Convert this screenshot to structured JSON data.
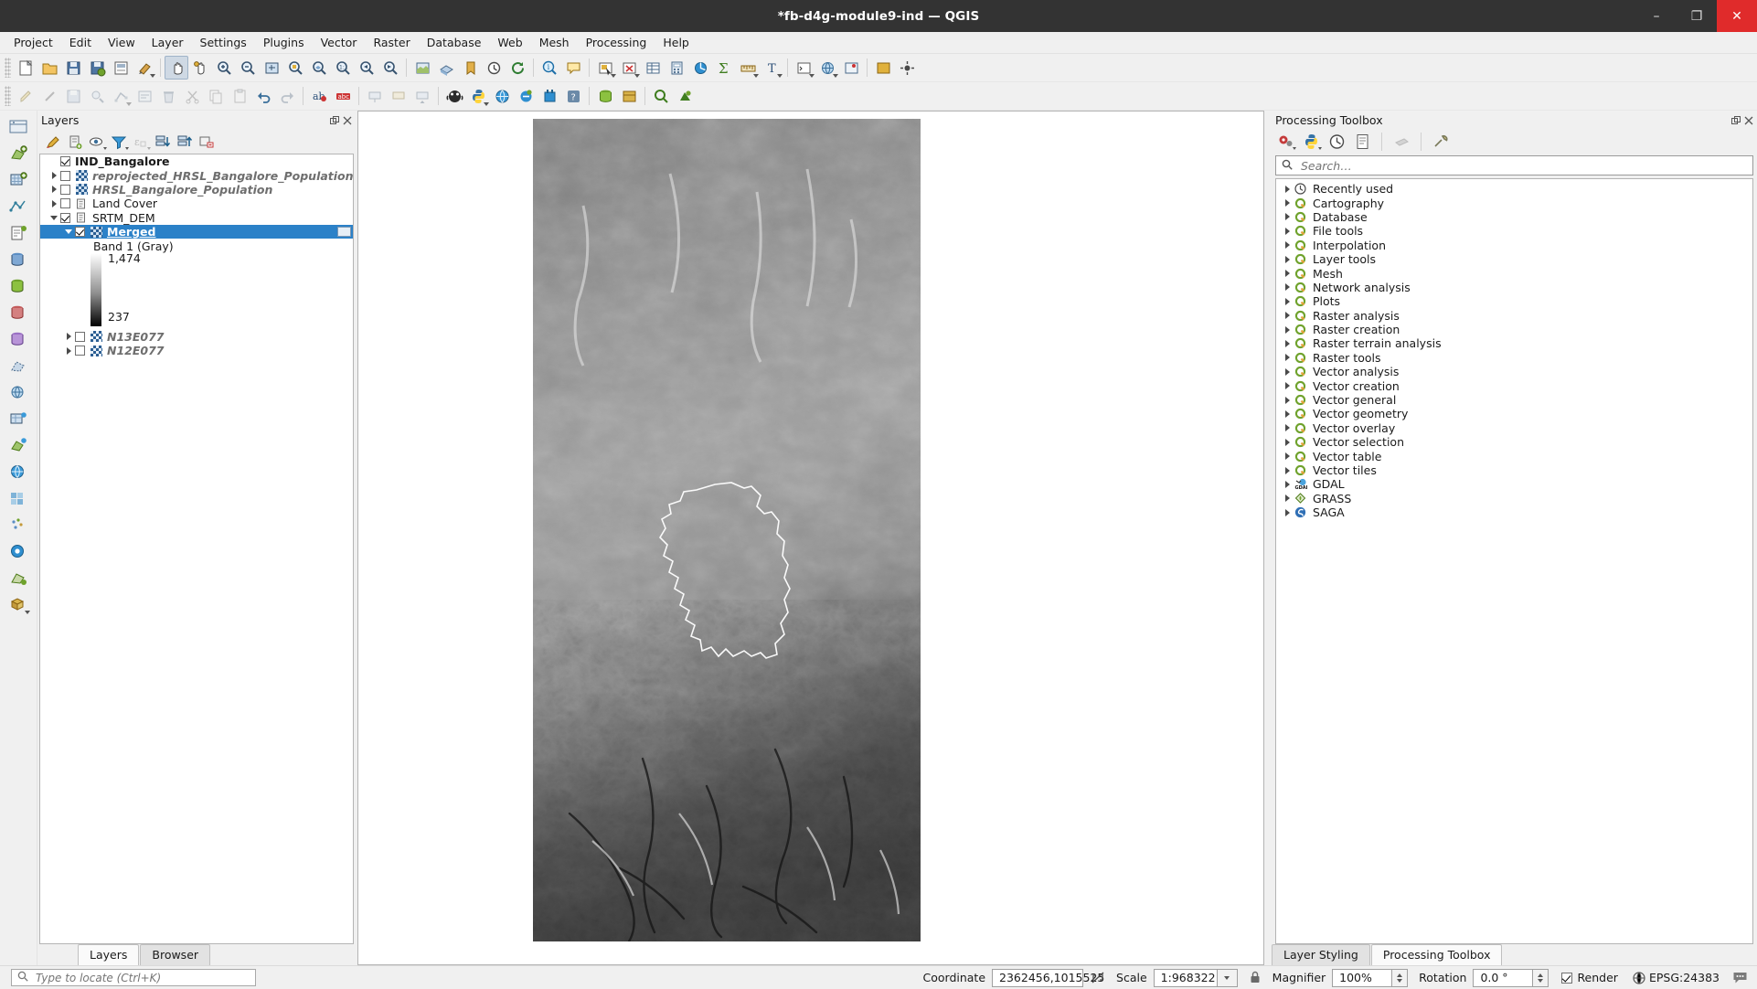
{
  "window": {
    "title": "*fb-d4g-module9-ind — QGIS",
    "minimize": "–",
    "maximize": "❐",
    "close": "✕"
  },
  "menubar": {
    "items": [
      "Project",
      "Edit",
      "View",
      "Layer",
      "Settings",
      "Plugins",
      "Vector",
      "Raster",
      "Database",
      "Web",
      "Mesh",
      "Processing",
      "Help"
    ]
  },
  "toolbars": {
    "row1_icons": [
      "new-project-icon",
      "open-project-icon",
      "save-project-icon",
      "save-project-as-icon",
      "new-print-layout-icon",
      "style-manager-icon",
      "pan-map-icon",
      "pan-to-selection-icon",
      "zoom-in-icon",
      "zoom-out-icon",
      "zoom-full-icon",
      "zoom-selection-icon",
      "zoom-layer-icon",
      "zoom-native-icon",
      "zoom-last-icon",
      "zoom-next-icon",
      "refresh-icon",
      "new-map-view-icon",
      "new-3d-map-view-icon",
      "show-bookmarks-icon",
      "temporal-controller-icon",
      "refresh-map-icon",
      "identify-features-icon",
      "map-tips-icon",
      "measure-icon",
      "select-features-icon",
      "deselect-icon",
      "open-attribute-table-icon",
      "field-calculator-icon",
      "statistical-summary-icon",
      "sum-icon",
      "measure-line-icon",
      "text-annotation-icon",
      "python-console-icon",
      "add-wms-icon",
      "georeferencer-icon",
      "mesh-calculator-icon",
      "add-delimited-text-icon"
    ],
    "row2_icons": [
      "pencil-edit-icon",
      "toggle-editing-icon",
      "save-layer-edits-icon",
      "add-feature-icon",
      "vertex-tool-icon",
      "modify-attributes-icon",
      "delete-selected-icon",
      "cut-features-icon",
      "copy-features-icon",
      "paste-features-icon",
      "undo-icon",
      "redo-icon",
      "label-icon",
      "pin-labels-icon",
      "show-hide-labels-icon",
      "highlight-labels-icon",
      "move-label-icon",
      "rotate-label-icon",
      "change-label-icon",
      "processing-toolbox-icon",
      "python-icon",
      "globe-icon",
      "metasearch-icon",
      "plugin-icon",
      "help-icon",
      "db-manager-icon",
      "geopackage-icon",
      "search-icon",
      "qgis-icon"
    ]
  },
  "left_rail": {
    "icons": [
      "open-data-source-manager-icon",
      "add-vector-layer-icon",
      "add-raster-layer-icon",
      "add-mesh-layer-icon",
      "add-delimited-text-layer-icon",
      "add-postgis-layer-icon",
      "add-spatialite-layer-icon",
      "add-mssql-layer-icon",
      "add-oracle-layer-icon",
      "add-virtual-layer-icon",
      "add-wms-layer-icon",
      "add-wcs-layer-icon",
      "add-wfs-layer-icon",
      "add-xyz-layer-icon",
      "add-vector-tile-layer-icon",
      "add-point-cloud-layer-icon",
      "add-arcgis-layer-icon",
      "new-shapefile-layer-icon",
      "new-geopackage-layer-icon"
    ]
  },
  "layers_panel": {
    "title": "Layers",
    "float_icon": "float-panel-icon",
    "close_icon": "close-panel-icon",
    "toolbar_icons": [
      "open-layer-styling-panel-icon",
      "add-group-icon",
      "manage-layer-visibility-icon",
      "filter-legend-icon",
      "filter-legend-by-expression-icon",
      "expand-all-icon",
      "collapse-all-icon",
      "remove-layer-icon"
    ],
    "tree": [
      {
        "label": "IND_Bangalore",
        "indent": 0,
        "checked": true,
        "expander": "none",
        "style": "bold",
        "icon": "none",
        "selected": false
      },
      {
        "label": "reprojected_HRSL_Bangalore_Population",
        "indent": 0,
        "checked": false,
        "expander": "right",
        "style": "italic",
        "icon": "raster-chip",
        "selected": false
      },
      {
        "label": "HRSL_Bangalore_Population",
        "indent": 0,
        "checked": false,
        "expander": "right",
        "style": "italic",
        "icon": "raster-chip",
        "selected": false
      },
      {
        "label": "Land Cover",
        "indent": 0,
        "checked": false,
        "expander": "right",
        "style": "normal",
        "icon": "group-icon",
        "selected": false
      },
      {
        "label": "SRTM_DEM",
        "indent": 0,
        "checked": true,
        "expander": "down",
        "style": "normal",
        "icon": "group-icon",
        "selected": false
      },
      {
        "label": "Merged",
        "indent": 1,
        "checked": true,
        "expander": "down",
        "style": "selected",
        "icon": "raster-chip",
        "selected": true
      },
      {
        "label": "Band 1 (Gray)",
        "indent": 2,
        "checked": null,
        "expander": "none",
        "style": "normal",
        "icon": "none",
        "selected": false
      }
    ],
    "legend": {
      "max_value": "1,474",
      "min_value": "237",
      "ramp_name": "grayscale-ramp"
    },
    "tree_tail": [
      {
        "label": "N13E077",
        "indent": 0,
        "checked": false,
        "expander": "right",
        "style": "italic",
        "icon": "raster-chip",
        "selected": false
      },
      {
        "label": "N12E077",
        "indent": 0,
        "checked": false,
        "expander": "right",
        "style": "italic",
        "icon": "raster-chip",
        "selected": false
      }
    ],
    "tabs": [
      {
        "label": "Layers",
        "active": true
      },
      {
        "label": "Browser",
        "active": false
      }
    ]
  },
  "processing_panel": {
    "title": "Processing Toolbox",
    "float_icon": "float-panel-icon",
    "close_icon": "close-panel-icon",
    "toolbar_icons": [
      "models-icon",
      "scripts-icon",
      "history-icon",
      "results-viewer-icon",
      "edit-features-in-place-icon",
      "options-icon"
    ],
    "search": {
      "placeholder": "Search…",
      "value": ""
    },
    "items": [
      {
        "label": "Recently used",
        "icon": "clock-icon"
      },
      {
        "label": "Cartography",
        "icon": "qgis-provider-icon"
      },
      {
        "label": "Database",
        "icon": "qgis-provider-icon"
      },
      {
        "label": "File tools",
        "icon": "qgis-provider-icon"
      },
      {
        "label": "Interpolation",
        "icon": "qgis-provider-icon"
      },
      {
        "label": "Layer tools",
        "icon": "qgis-provider-icon"
      },
      {
        "label": "Mesh",
        "icon": "qgis-provider-icon"
      },
      {
        "label": "Network analysis",
        "icon": "qgis-provider-icon"
      },
      {
        "label": "Plots",
        "icon": "qgis-provider-icon"
      },
      {
        "label": "Raster analysis",
        "icon": "qgis-provider-icon"
      },
      {
        "label": "Raster creation",
        "icon": "qgis-provider-icon"
      },
      {
        "label": "Raster terrain analysis",
        "icon": "qgis-provider-icon"
      },
      {
        "label": "Raster tools",
        "icon": "qgis-provider-icon"
      },
      {
        "label": "Vector analysis",
        "icon": "qgis-provider-icon"
      },
      {
        "label": "Vector creation",
        "icon": "qgis-provider-icon"
      },
      {
        "label": "Vector general",
        "icon": "qgis-provider-icon"
      },
      {
        "label": "Vector geometry",
        "icon": "qgis-provider-icon"
      },
      {
        "label": "Vector overlay",
        "icon": "qgis-provider-icon"
      },
      {
        "label": "Vector selection",
        "icon": "qgis-provider-icon"
      },
      {
        "label": "Vector table",
        "icon": "qgis-provider-icon"
      },
      {
        "label": "Vector tiles",
        "icon": "qgis-provider-icon"
      },
      {
        "label": "GDAL",
        "icon": "gdal-provider-icon"
      },
      {
        "label": "GRASS",
        "icon": "grass-provider-icon"
      },
      {
        "label": "SAGA",
        "icon": "saga-provider-icon"
      }
    ],
    "tabs": [
      {
        "label": "Layer Styling",
        "active": false
      },
      {
        "label": "Processing Toolbox",
        "active": true
      }
    ]
  },
  "map": {
    "layer_name": "Merged",
    "boundary_name": "IND_Bangalore"
  },
  "statusbar": {
    "locator_placeholder": "Type to locate (Ctrl+K)",
    "locator_value": "",
    "locator_icon": "search-icon",
    "coordinate_label": "Coordinate",
    "coordinate_value": "2362456,1015525",
    "toggle_extents_icon": "toggle-extents-icon",
    "scale_label": "Scale",
    "scale_value": "1:968322",
    "scale_lock_icon": "lock-scale-icon",
    "magnifier_label": "Magnifier",
    "magnifier_value": "100%",
    "rotation_label": "Rotation",
    "rotation_value": "0.0 °",
    "render_label": "Render",
    "render_checked": true,
    "crs_label": "EPSG:24383",
    "crs_icon": "globe-icon",
    "messages_icon": "messages-icon"
  },
  "colors": {
    "titlebar_bg": "#333333",
    "close_btn": "#e02b2b",
    "selection_blue": "#2b81c8",
    "panel_bg": "#f0f0f0",
    "qgis_green": "#6fa22c"
  }
}
